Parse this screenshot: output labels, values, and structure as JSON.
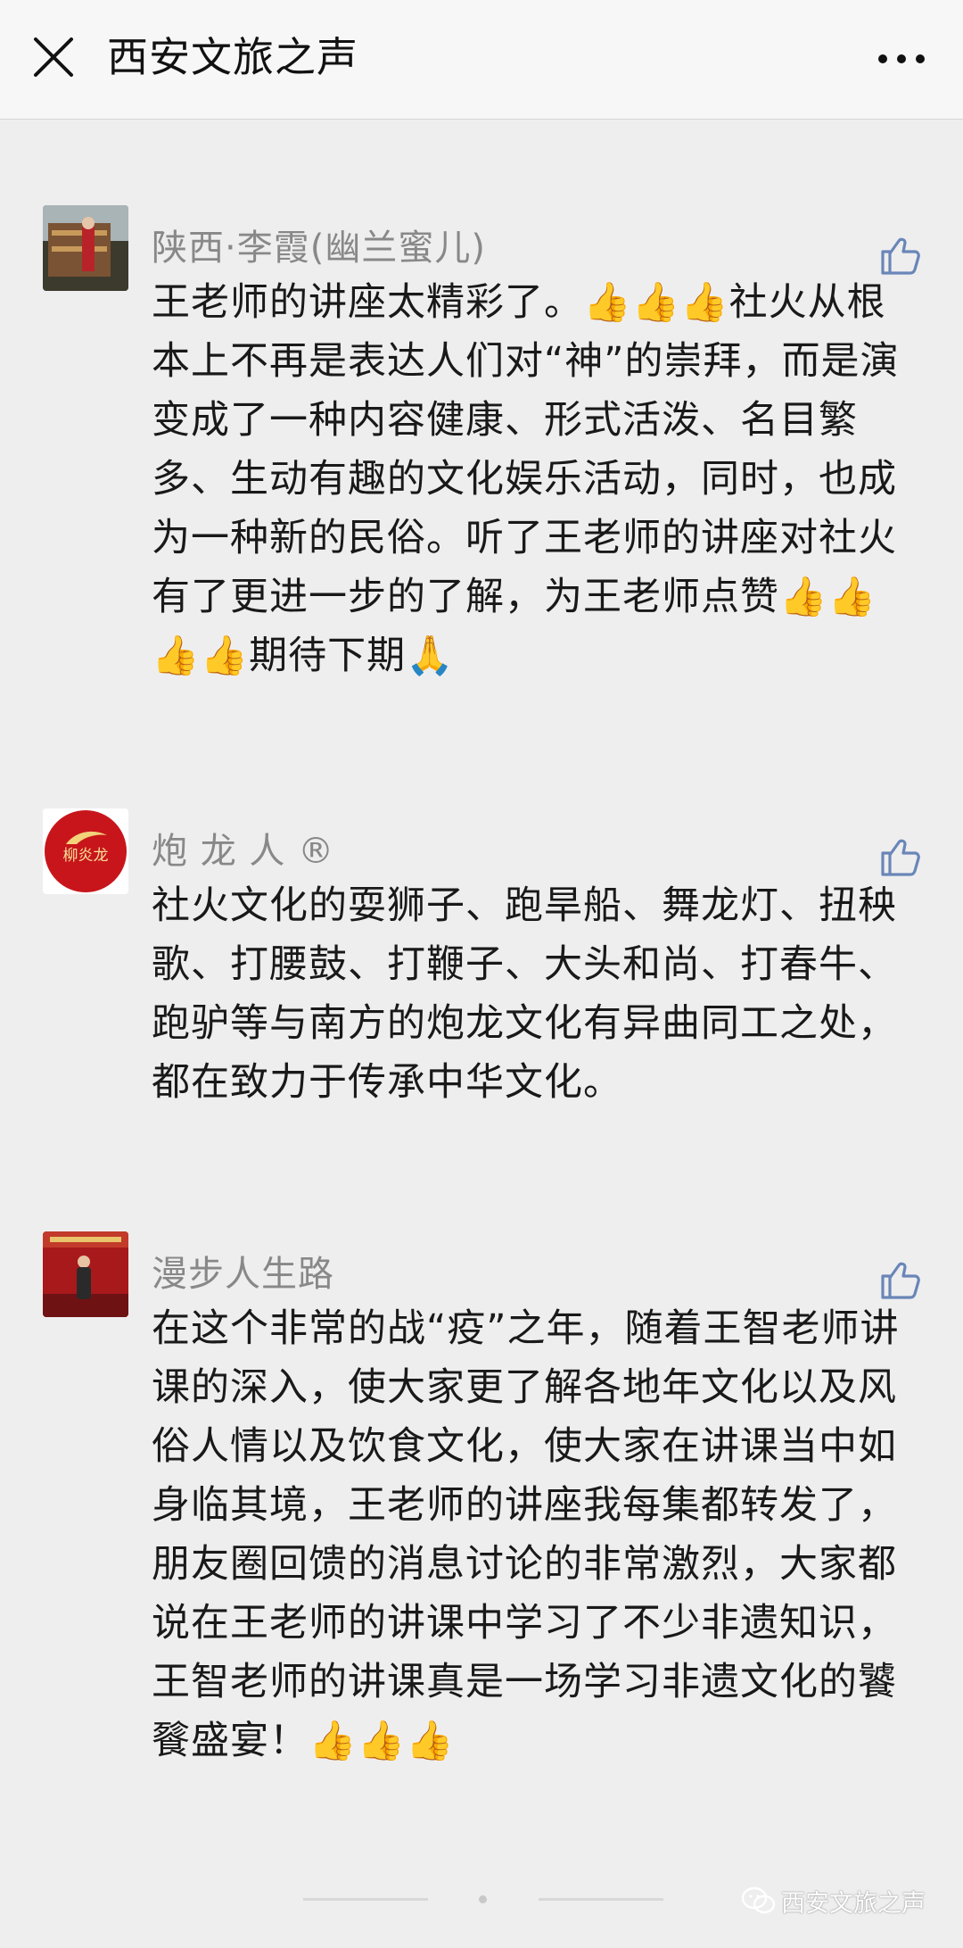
{
  "header": {
    "title": "西安文旅之声",
    "close_icon": "close-icon",
    "more_icon": "more-icon"
  },
  "comments": [
    {
      "nickname": "陕西·李霞(幽兰蜜儿)",
      "text": "王老师的讲座太精彩了。👍👍👍社火从根本上不再是表达人们对“神”的崇拜，而是演变成了一种内容健康、形式活泼、名目繁多、生动有趣的文化娱乐活动，同时，也成为一种新的民俗。听了王老师的讲座对社火有了更进一步的了解，为王老师点赞👍👍👍👍期待下期🙏"
    },
    {
      "nickname": "炮 龙 人 ®",
      "avatar_text": "柳炎龙",
      "text": "社火文化的耍狮子、跑旱船、舞龙灯、扭秧歌、打腰鼓、打鞭子、大头和尚、打春牛、跑驴等与南方的炮龙文化有异曲同工之处，都在致力于传承中华文化。"
    },
    {
      "nickname": "漫步人生路",
      "text": "在这个非常的战“疫”之年，随着王智老师讲课的深入，使大家更了解各地年文化以及风俗人情以及饮食文化，使大家在讲课当中如身临其境，王老师的讲座我每集都转发了，朋友圈回馈的消息讨论的非常激烈，大家都说在王老师的讲课中学习了不少非遗知识，王智老师的讲课真是一场学习非遗文化的饕餮盛宴！👍👍👍"
    }
  ],
  "watermark": {
    "text": "西安文旅之声"
  },
  "colors": {
    "background": "#eeeeef",
    "nickname": "#888888",
    "content": "#191919",
    "avatar_logo_red": "#c8151b"
  }
}
